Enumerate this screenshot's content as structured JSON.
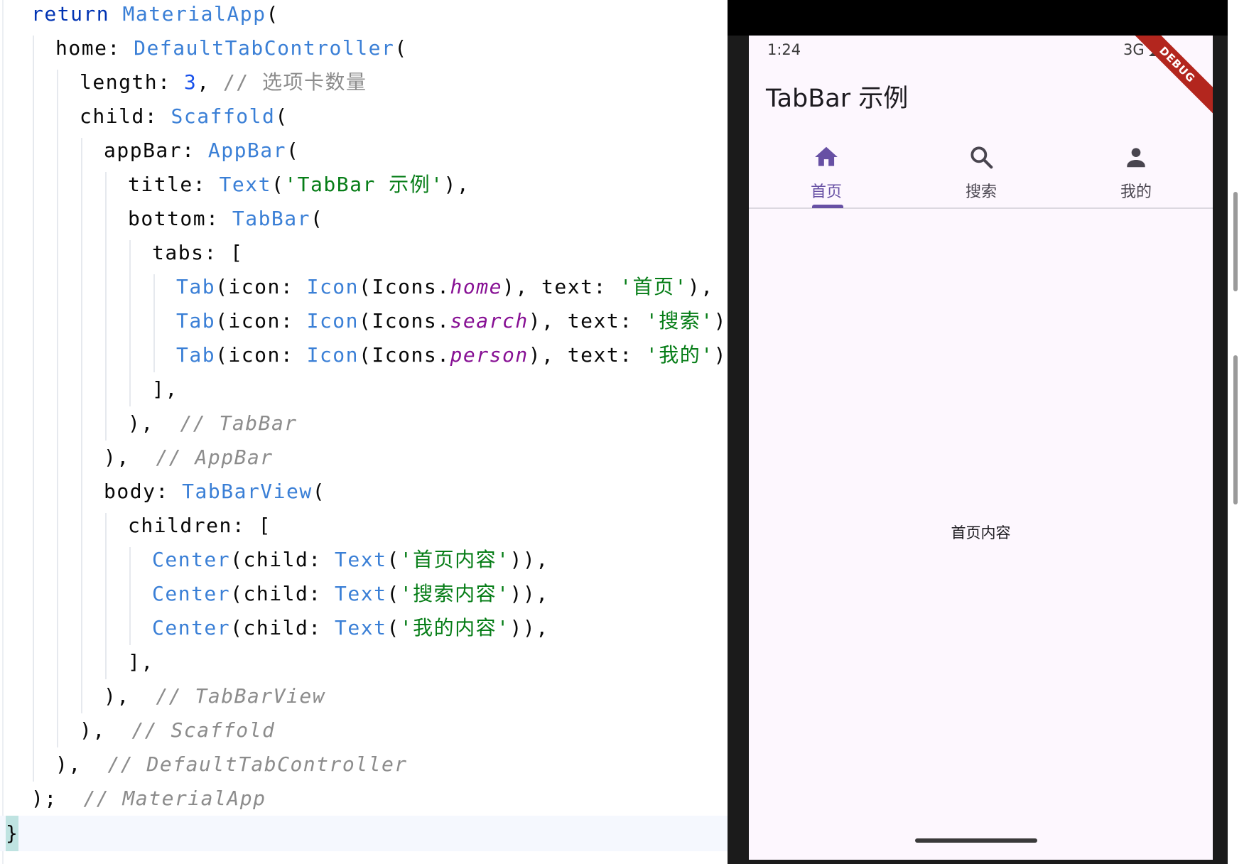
{
  "editor": {
    "lines": [
      {
        "indent": 1,
        "parts": [
          [
            "kw",
            "return "
          ],
          [
            "cls",
            "MaterialApp"
          ],
          [
            "p",
            "("
          ]
        ]
      },
      {
        "indent": 2,
        "parts": [
          [
            "p",
            "home: "
          ],
          [
            "cls",
            "DefaultTabController"
          ],
          [
            "p",
            "("
          ]
        ]
      },
      {
        "indent": 3,
        "parts": [
          [
            "p",
            "length: "
          ],
          [
            "num",
            "3"
          ],
          [
            "p",
            ", "
          ],
          [
            "cmt-cn",
            "// 选项卡数量"
          ]
        ]
      },
      {
        "indent": 3,
        "parts": [
          [
            "p",
            "child: "
          ],
          [
            "cls",
            "Scaffold"
          ],
          [
            "p",
            "("
          ]
        ]
      },
      {
        "indent": 4,
        "parts": [
          [
            "p",
            "appBar: "
          ],
          [
            "cls",
            "AppBar"
          ],
          [
            "p",
            "("
          ]
        ]
      },
      {
        "indent": 5,
        "parts": [
          [
            "p",
            "title: "
          ],
          [
            "cls",
            "Text"
          ],
          [
            "p",
            "("
          ],
          [
            "str",
            "'TabBar 示例'"
          ],
          [
            "p",
            "),"
          ]
        ]
      },
      {
        "indent": 5,
        "parts": [
          [
            "p",
            "bottom: "
          ],
          [
            "cls",
            "TabBar"
          ],
          [
            "p",
            "("
          ]
        ]
      },
      {
        "indent": 6,
        "parts": [
          [
            "p",
            "tabs: ["
          ]
        ]
      },
      {
        "indent": 7,
        "parts": [
          [
            "cls",
            "Tab"
          ],
          [
            "p",
            "(icon: "
          ],
          [
            "cls",
            "Icon"
          ],
          [
            "p",
            "(Icons."
          ],
          [
            "prop",
            "home"
          ],
          [
            "p",
            "), text: "
          ],
          [
            "str",
            "'首页'"
          ],
          [
            "p",
            "),"
          ]
        ]
      },
      {
        "indent": 7,
        "parts": [
          [
            "cls",
            "Tab"
          ],
          [
            "p",
            "(icon: "
          ],
          [
            "cls",
            "Icon"
          ],
          [
            "p",
            "(Icons."
          ],
          [
            "prop",
            "search"
          ],
          [
            "p",
            "), text: "
          ],
          [
            "str",
            "'搜索'"
          ],
          [
            "p",
            "),"
          ]
        ]
      },
      {
        "indent": 7,
        "parts": [
          [
            "cls",
            "Tab"
          ],
          [
            "p",
            "(icon: "
          ],
          [
            "cls",
            "Icon"
          ],
          [
            "p",
            "(Icons."
          ],
          [
            "prop",
            "person"
          ],
          [
            "p",
            "), text: "
          ],
          [
            "str",
            "'我的'"
          ],
          [
            "p",
            "),"
          ]
        ]
      },
      {
        "indent": 6,
        "parts": [
          [
            "p",
            "],"
          ]
        ]
      },
      {
        "indent": 5,
        "parts": [
          [
            "p",
            "),  "
          ],
          [
            "cmt",
            "// TabBar"
          ]
        ]
      },
      {
        "indent": 4,
        "parts": [
          [
            "p",
            "),  "
          ],
          [
            "cmt",
            "// AppBar"
          ]
        ]
      },
      {
        "indent": 4,
        "parts": [
          [
            "p",
            "body: "
          ],
          [
            "cls",
            "TabBarView"
          ],
          [
            "p",
            "("
          ]
        ]
      },
      {
        "indent": 5,
        "parts": [
          [
            "p",
            "children: ["
          ]
        ]
      },
      {
        "indent": 6,
        "parts": [
          [
            "cls",
            "Center"
          ],
          [
            "p",
            "(child: "
          ],
          [
            "cls",
            "Text"
          ],
          [
            "p",
            "("
          ],
          [
            "str",
            "'首页内容'"
          ],
          [
            "p",
            ")),"
          ]
        ]
      },
      {
        "indent": 6,
        "parts": [
          [
            "cls",
            "Center"
          ],
          [
            "p",
            "(child: "
          ],
          [
            "cls",
            "Text"
          ],
          [
            "p",
            "("
          ],
          [
            "str",
            "'搜索内容'"
          ],
          [
            "p",
            ")),"
          ]
        ]
      },
      {
        "indent": 6,
        "parts": [
          [
            "cls",
            "Center"
          ],
          [
            "p",
            "(child: "
          ],
          [
            "cls",
            "Text"
          ],
          [
            "p",
            "("
          ],
          [
            "str",
            "'我的内容'"
          ],
          [
            "p",
            ")),"
          ]
        ]
      },
      {
        "indent": 5,
        "parts": [
          [
            "p",
            "],"
          ]
        ]
      },
      {
        "indent": 4,
        "parts": [
          [
            "p",
            "),  "
          ],
          [
            "cmt",
            "// TabBarView"
          ]
        ]
      },
      {
        "indent": 3,
        "parts": [
          [
            "p",
            "),  "
          ],
          [
            "cmt",
            "// Scaffold"
          ]
        ]
      },
      {
        "indent": 2,
        "parts": [
          [
            "p",
            "),  "
          ],
          [
            "cmt",
            "// DefaultTabController"
          ]
        ]
      },
      {
        "indent": 1,
        "parts": [
          [
            "p",
            ");  "
          ],
          [
            "cmt",
            "// MaterialApp"
          ]
        ]
      }
    ],
    "closing_brace": "}"
  },
  "phone": {
    "status_time": "1:24",
    "status_network": "3G",
    "debug_banner": "DEBUG",
    "appbar_title": "TabBar 示例",
    "tabs": [
      {
        "icon": "home-icon",
        "label": "首页",
        "active": true
      },
      {
        "icon": "search-icon",
        "label": "搜索",
        "active": false
      },
      {
        "icon": "person-icon",
        "label": "我的",
        "active": false
      }
    ],
    "body_text": "首页内容"
  },
  "colors": {
    "accent": "#6750a4",
    "screen_bg": "#fdf7fe",
    "debug_red": "#b3261e"
  }
}
